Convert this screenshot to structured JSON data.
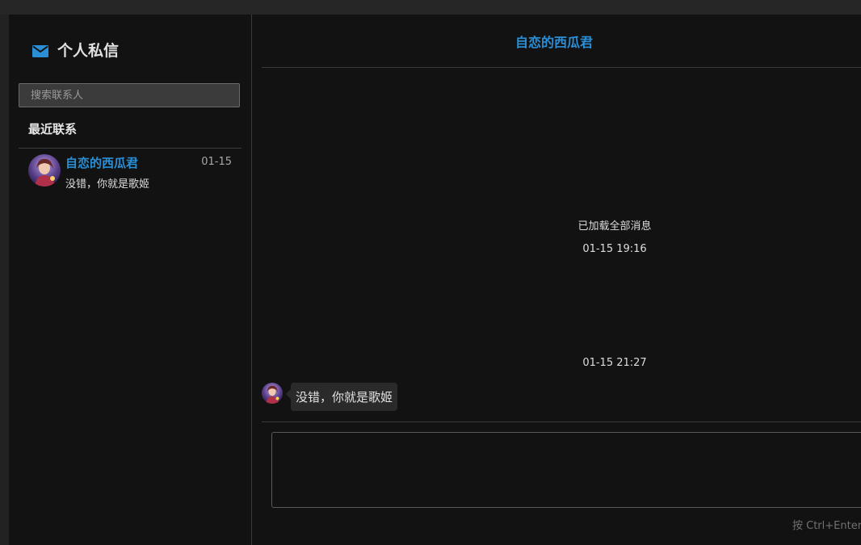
{
  "sidebar": {
    "title": "个人私信",
    "search_placeholder": "搜索联系人",
    "recent_label": "最近联系",
    "contacts": [
      {
        "name": "自恋的西瓜君",
        "date": "01-15",
        "preview": "没错，你就是歌姬"
      }
    ]
  },
  "chat": {
    "title": "自恋的西瓜君",
    "loaded_note": "已加载全部消息",
    "timestamps": [
      "01-15 19:16",
      "01-15 21:27"
    ],
    "messages": [
      {
        "text": "没错，你就是歌姬"
      }
    ],
    "compose_hint": "按 Ctrl+Enter"
  },
  "colors": {
    "accent": "#2a8fd6",
    "background": "#121212",
    "bubble": "#2a2a2a"
  },
  "icons": {
    "title_icon": "mail-icon"
  }
}
